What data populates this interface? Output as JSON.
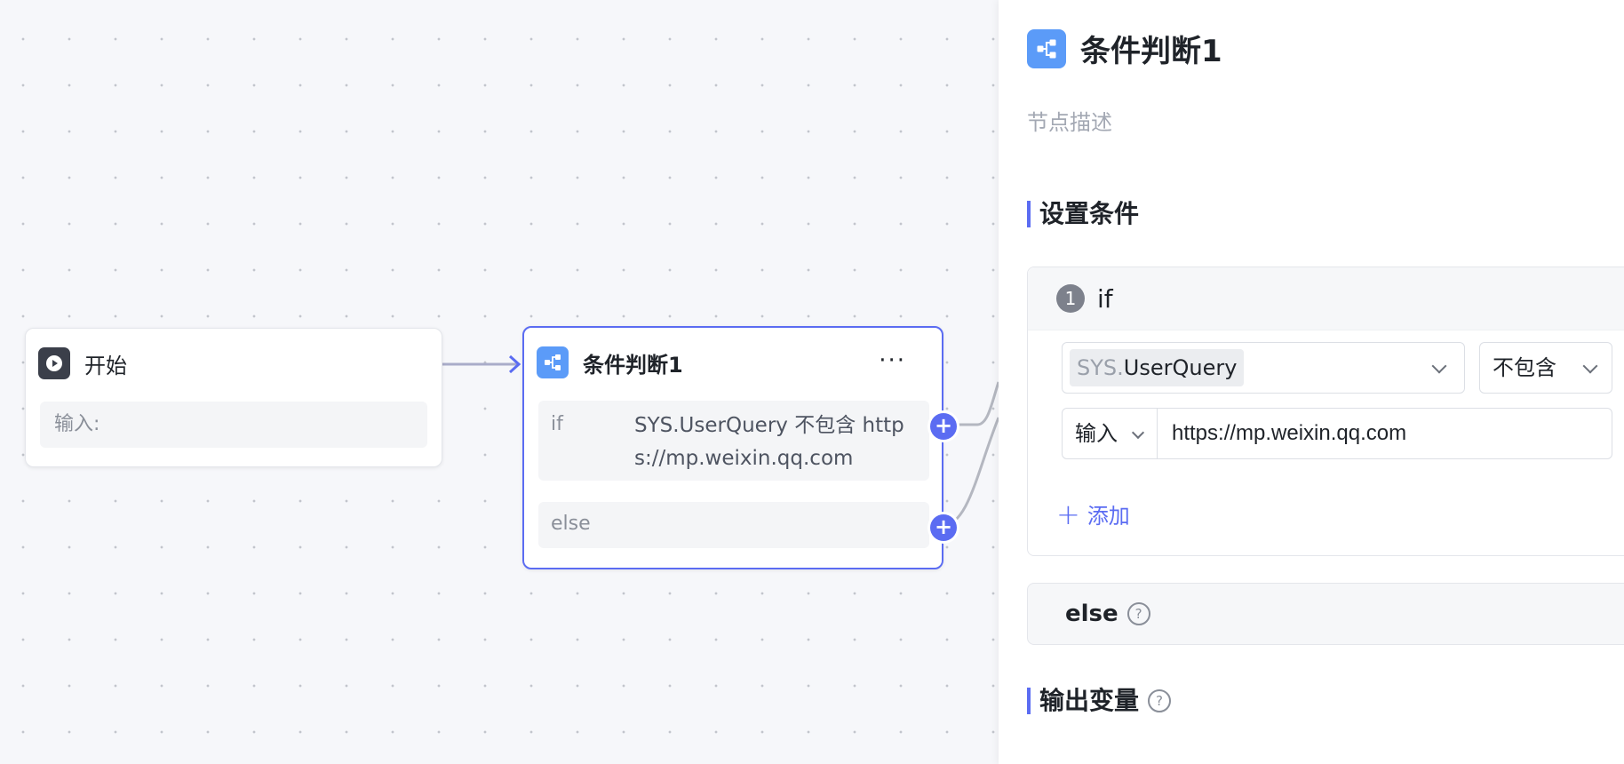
{
  "canvas": {
    "start_node": {
      "icon": "play-icon",
      "title": "开始",
      "input_label": "输入:"
    },
    "condition_node": {
      "icon": "branch-icon",
      "title": "条件判断1",
      "more": "···",
      "if_key": "if",
      "if_text": "SYS.UserQuery 不包含 https://mp.weixin.qq.com",
      "else_key": "else",
      "add_branch": "+"
    }
  },
  "panel": {
    "title": "条件判断1",
    "description_placeholder": "节点描述",
    "conditions_section": "设置条件",
    "if_block": {
      "index": "1",
      "label": "if",
      "variable_prefix": "SYS.",
      "variable_name": "UserQuery",
      "operator": "不包含",
      "source": "输入",
      "value": "https://mp.weixin.qq.com",
      "add_label": "添加"
    },
    "else_label": "else",
    "output_section": "输出变量",
    "help": "?"
  },
  "colors": {
    "accent": "#5b6cf2",
    "node_icon_blue": "#5b9bf8",
    "node_icon_dark": "#3b3f4a",
    "canvas_bg": "#f6f7fa"
  }
}
